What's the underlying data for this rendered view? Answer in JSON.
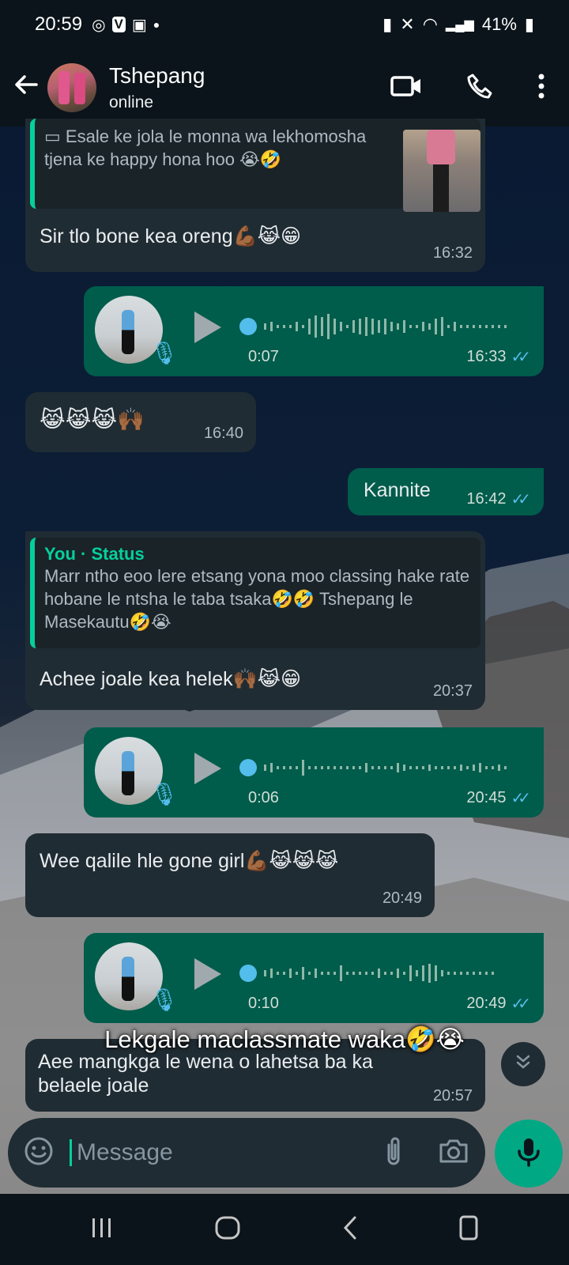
{
  "statusbar": {
    "time": "20:59",
    "battery": "41%"
  },
  "header": {
    "contact_name": "Tshepang",
    "contact_status": "online"
  },
  "messages": {
    "m1": {
      "quote_text": "Esale ke jola le monna wa lekhomosha tjena ke happy hona hoo 😭🤣",
      "text": "Sir tlo bone kea oreng💪🏾😹😁",
      "time": "16:32"
    },
    "m2": {
      "duration": "0:07",
      "time": "16:33"
    },
    "m3": {
      "text": "😹😹😹🙌🏾",
      "time": "16:40"
    },
    "m4": {
      "text": "Kannite",
      "time": "16:42"
    },
    "m5": {
      "quote_author": "You · Status",
      "quote_text": "Marr ntho eoo lere etsang yona moo classing hake rate hobane le ntsha le taba tsaka🤣🤣 Tshepang le Masekautu🤣😭",
      "text": "Achee joale kea helek🙌🏾😹😁",
      "time": "20:37"
    },
    "m6": {
      "duration": "0:06",
      "time": "20:45"
    },
    "m7": {
      "text": "Wee qalile hle gone girl💪🏾😹😹😹",
      "time": "20:49"
    },
    "m8": {
      "duration": "0:10",
      "time": "20:49"
    },
    "m9": {
      "text": "Aee mangkga le wena o lahetsa ba ka belaele joale",
      "time": "20:57"
    }
  },
  "caption": "Lekgale maclassmate waka🤣😭",
  "composer": {
    "placeholder": "Message"
  },
  "colors": {
    "accent": "#00a884",
    "outgoing": "#005c4b",
    "incoming": "#202c33",
    "read_ticks": "#53bdeb"
  },
  "icons": [
    "back-arrow-icon",
    "video-call-icon",
    "phone-icon",
    "more-vert-icon",
    "emoji-icon",
    "attach-icon",
    "camera-icon",
    "mic-icon",
    "chevron-down-icon",
    "play-icon"
  ]
}
